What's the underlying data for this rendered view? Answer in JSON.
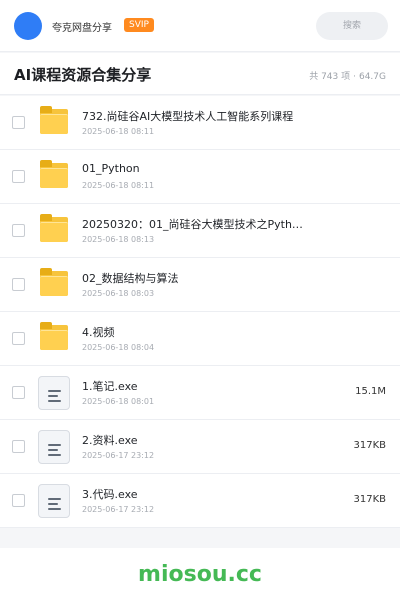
{
  "header": {
    "sharer_name": "夸克网盘分享",
    "badge": "SVIP",
    "search_placeholder": "搜索"
  },
  "collection": {
    "title": "AI课程资源合集分享",
    "count": "共 743 项",
    "separator": "·",
    "total_size": "64.7G"
  },
  "files": [
    {
      "type": "folder",
      "name": "732.尚硅谷AI大模型技术人工智能系列课程",
      "date": "2025-06-18 08:11",
      "size": ""
    },
    {
      "type": "folder",
      "name": "01_Python",
      "date": "2025-06-18 08:11",
      "size": ""
    },
    {
      "type": "folder",
      "name": "20250320：01_尚硅谷大模型技术之Pyth…",
      "date": "2025-06-18 08:13",
      "size": ""
    },
    {
      "type": "folder",
      "name": "02_数据结构与算法",
      "date": "2025-06-18 08:03",
      "size": ""
    },
    {
      "type": "folder",
      "name": "4.视频",
      "date": "2025-06-18 08:04",
      "size": ""
    },
    {
      "type": "file",
      "name": "1.笔记.exe",
      "date": "2025-06-18 08:01",
      "size": "15.1M"
    },
    {
      "type": "file",
      "name": "2.资料.exe",
      "date": "2025-06-17 23:12",
      "size": "317KB"
    },
    {
      "type": "file",
      "name": "3.代码.exe",
      "date": "2025-06-17 23:12",
      "size": "317KB"
    }
  ],
  "footer": {
    "brand": "miosou.cc"
  },
  "colors": {
    "avatar": "#2f7df6",
    "badge": "#ff8a1f",
    "folder": "#ffd050",
    "brand": "#45b955"
  }
}
